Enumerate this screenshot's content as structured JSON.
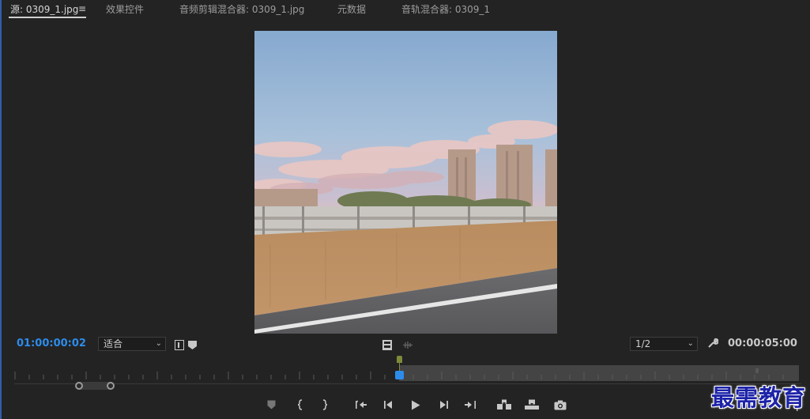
{
  "tabs": [
    {
      "label": "源: 0309_1.jpg",
      "active": true
    },
    {
      "label": "效果控件",
      "active": false
    },
    {
      "label": "音频剪辑混合器: 0309_1.jpg",
      "active": false
    },
    {
      "label": "元数据",
      "active": false
    },
    {
      "label": "音轨混合器: 0309_1",
      "active": false
    }
  ],
  "tab_menu_icon": "≡",
  "current_timecode": "01:00:00:02",
  "duration_timecode": "00:00:05:00",
  "zoom_select": {
    "value": "适合"
  },
  "resolution_select": {
    "value": "1/2"
  },
  "playhead_fraction": 0.49,
  "watermark": "最需教育",
  "colors": {
    "accent": "#2d8ceb",
    "playhead": "#7c8c3a",
    "background": "#232323"
  },
  "icons": {
    "transport": [
      "add-marker-icon",
      "mark-in-icon",
      "mark-out-icon",
      "go-to-in-icon",
      "step-back-icon",
      "play-icon",
      "step-forward-icon",
      "go-to-out-icon",
      "insert-icon",
      "overwrite-icon",
      "export-frame-icon"
    ],
    "plus": "+"
  }
}
